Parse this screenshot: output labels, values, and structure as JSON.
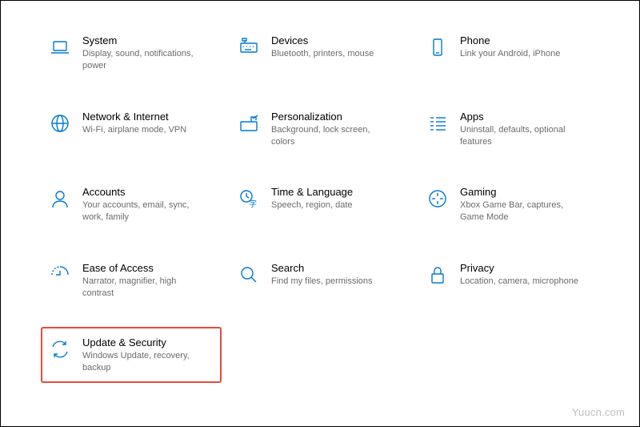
{
  "accent_color": "#0078d4",
  "highlight_color": "#e74c3c",
  "watermark": "Yuucn.com",
  "items": [
    {
      "title": "System",
      "subtitle": "Display, sound, notifications, power",
      "icon": "laptop",
      "highlighted": false
    },
    {
      "title": "Devices",
      "subtitle": "Bluetooth, printers, mouse",
      "icon": "keyboard",
      "highlighted": false
    },
    {
      "title": "Phone",
      "subtitle": "Link your Android, iPhone",
      "icon": "phone",
      "highlighted": false
    },
    {
      "title": "Network & Internet",
      "subtitle": "Wi-Fi, airplane mode, VPN",
      "icon": "globe",
      "highlighted": false
    },
    {
      "title": "Personalization",
      "subtitle": "Background, lock screen, colors",
      "icon": "paint",
      "highlighted": false
    },
    {
      "title": "Apps",
      "subtitle": "Uninstall, defaults, optional features",
      "icon": "apps",
      "highlighted": false
    },
    {
      "title": "Accounts",
      "subtitle": "Your accounts, email, sync, work, family",
      "icon": "account",
      "highlighted": false
    },
    {
      "title": "Time & Language",
      "subtitle": "Speech, region, date",
      "icon": "time-language",
      "highlighted": false
    },
    {
      "title": "Gaming",
      "subtitle": "Xbox Game Bar, captures, Game Mode",
      "icon": "gaming",
      "highlighted": false
    },
    {
      "title": "Ease of Access",
      "subtitle": "Narrator, magnifier, high contrast",
      "icon": "ease",
      "highlighted": false
    },
    {
      "title": "Search",
      "subtitle": "Find my files, permissions",
      "icon": "search",
      "highlighted": false
    },
    {
      "title": "Privacy",
      "subtitle": "Location, camera, microphone",
      "icon": "privacy",
      "highlighted": false
    },
    {
      "title": "Update & Security",
      "subtitle": "Windows Update, recovery, backup",
      "icon": "update",
      "highlighted": true
    }
  ]
}
